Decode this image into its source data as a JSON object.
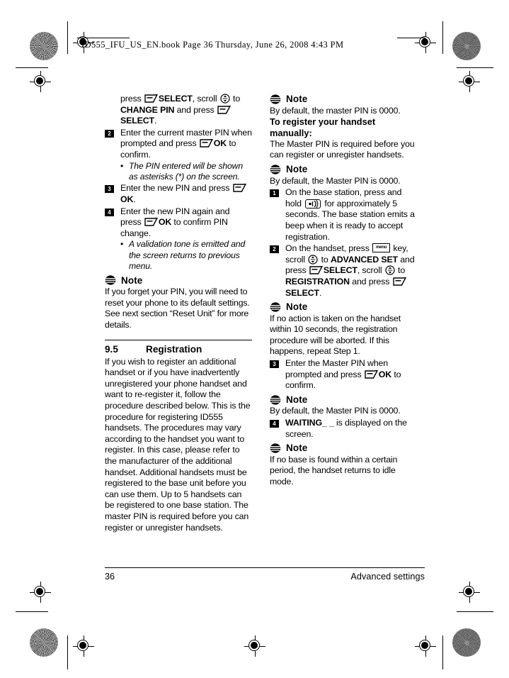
{
  "sheet": {
    "banner": "ID555_IFU_US_EN.book  Page 36  Thursday, June 26, 2008  4:43 PM"
  },
  "icons": {
    "note": "note-icon",
    "softkey": "softkey-icon",
    "scroll": "scroll-key-icon",
    "menu_key_label": "menu",
    "paging_key": "paging-key-icon"
  },
  "left_column": {
    "step1_continuation": {
      "part1": "press ",
      "bold1": "SELECT",
      "part2": ", scroll ",
      "part3": " to ",
      "bold2": "CHANGE PIN",
      "part4": " and press ",
      "bold3": "SELECT",
      "part5": "."
    },
    "step2": {
      "num": "2",
      "part1": "Enter the current master PIN when prompted and press ",
      "bold1": "OK",
      "part2": " to confirm."
    },
    "bullet1": "The PIN entered will be shown as asterisks (*) on the screen.",
    "step3": {
      "num": "3",
      "part1": "Enter the new PIN and press ",
      "bold1": "OK",
      "part2": "."
    },
    "step4": {
      "num": "4",
      "part1": "Enter the new PIN again and press ",
      "bold1": "OK",
      "part2": " to confirm PIN change."
    },
    "bullet2": "A validation tone is emitted and the screen returns to previous menu.",
    "note1": {
      "label": "Note",
      "text": "If you forget your PIN, you will need to reset your phone to its default settings. See next section “Reset Unit” for more details."
    },
    "section": {
      "number": "9.5",
      "title": "Registration",
      "body": "If you wish to register an additional handset or if you have inadvertently unregistered your phone handset and want to re-register it, follow the procedure described below. This is the procedure for registering ID555 handsets. The procedures may vary according to the handset you want to register. In this case, please refer to the manufacturer of the additional handset. Additional handsets must be registered to the base unit before you can use them. Up to 5 handsets can be registered to one base station. The master PIN is required before you can register or unregister handsets."
    }
  },
  "right_column": {
    "note1": {
      "label": "Note",
      "text": "By default, the master PIN is 0000."
    },
    "subheading": "To register your handset manually:",
    "intro": "The Master PIN is required before you can register or unregister handsets.",
    "note2": {
      "label": "Note",
      "text": "By default, the Master PIN is 0000."
    },
    "step1": {
      "num": "1",
      "part1": "On the base station, press and hold ",
      "part2": " for approximately 5 seconds. The base station emits a beep when it is ready to accept registration."
    },
    "step2": {
      "num": "2",
      "part1": "On the handset, press ",
      "part2": " key, scroll ",
      "part3": " to ",
      "bold1": "ADVANCED SET",
      "part4": " and press ",
      "bold2": "SELECT",
      "part5": ", scroll ",
      "part6": " to ",
      "bold3": "REGISTRATION",
      "part7": " and press ",
      "bold4": "SELECT",
      "part8": "."
    },
    "note3": {
      "label": "Note",
      "text": "If no action is taken on the handset within 10 seconds, the registration procedure will be aborted. If this happens, repeat Step 1."
    },
    "step3": {
      "num": "3",
      "part1": "Enter the Master PIN when prompted and press ",
      "bold1": "OK",
      "part2": " to confirm."
    },
    "note4": {
      "label": "Note",
      "text": "By default, the Master PIN is 0000."
    },
    "step4": {
      "num": "4",
      "bold1": "WAITING_ _",
      "part1": " is displayed on the screen."
    },
    "note5": {
      "label": "Note",
      "text": "If no base is found within a certain period, the handset returns to idle mode."
    }
  },
  "footer": {
    "page_number": "36",
    "section_name": "Advanced settings"
  }
}
